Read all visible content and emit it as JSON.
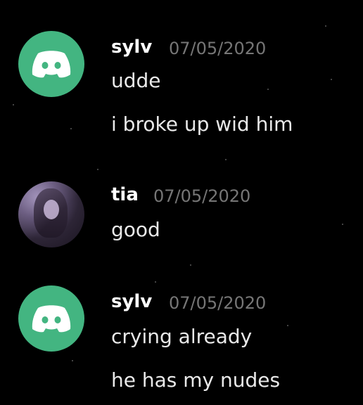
{
  "colors": {
    "background": "#000000",
    "discord_avatar": "#43b581",
    "username": "#ffffff",
    "timestamp": "#767676",
    "message_text": "#e9e9e9"
  },
  "messages": [
    {
      "username": "sylv",
      "timestamp": "07/05/2020",
      "avatar": "discord-default-icon",
      "lines": [
        "udde",
        "i broke up wid him"
      ]
    },
    {
      "username": "tia",
      "timestamp": "07/05/2020",
      "avatar": "photo",
      "lines": [
        "good"
      ]
    },
    {
      "username": "sylv",
      "timestamp": "07/05/2020",
      "avatar": "discord-default-icon",
      "lines": [
        "crying already",
        "he has my nudes"
      ]
    }
  ]
}
